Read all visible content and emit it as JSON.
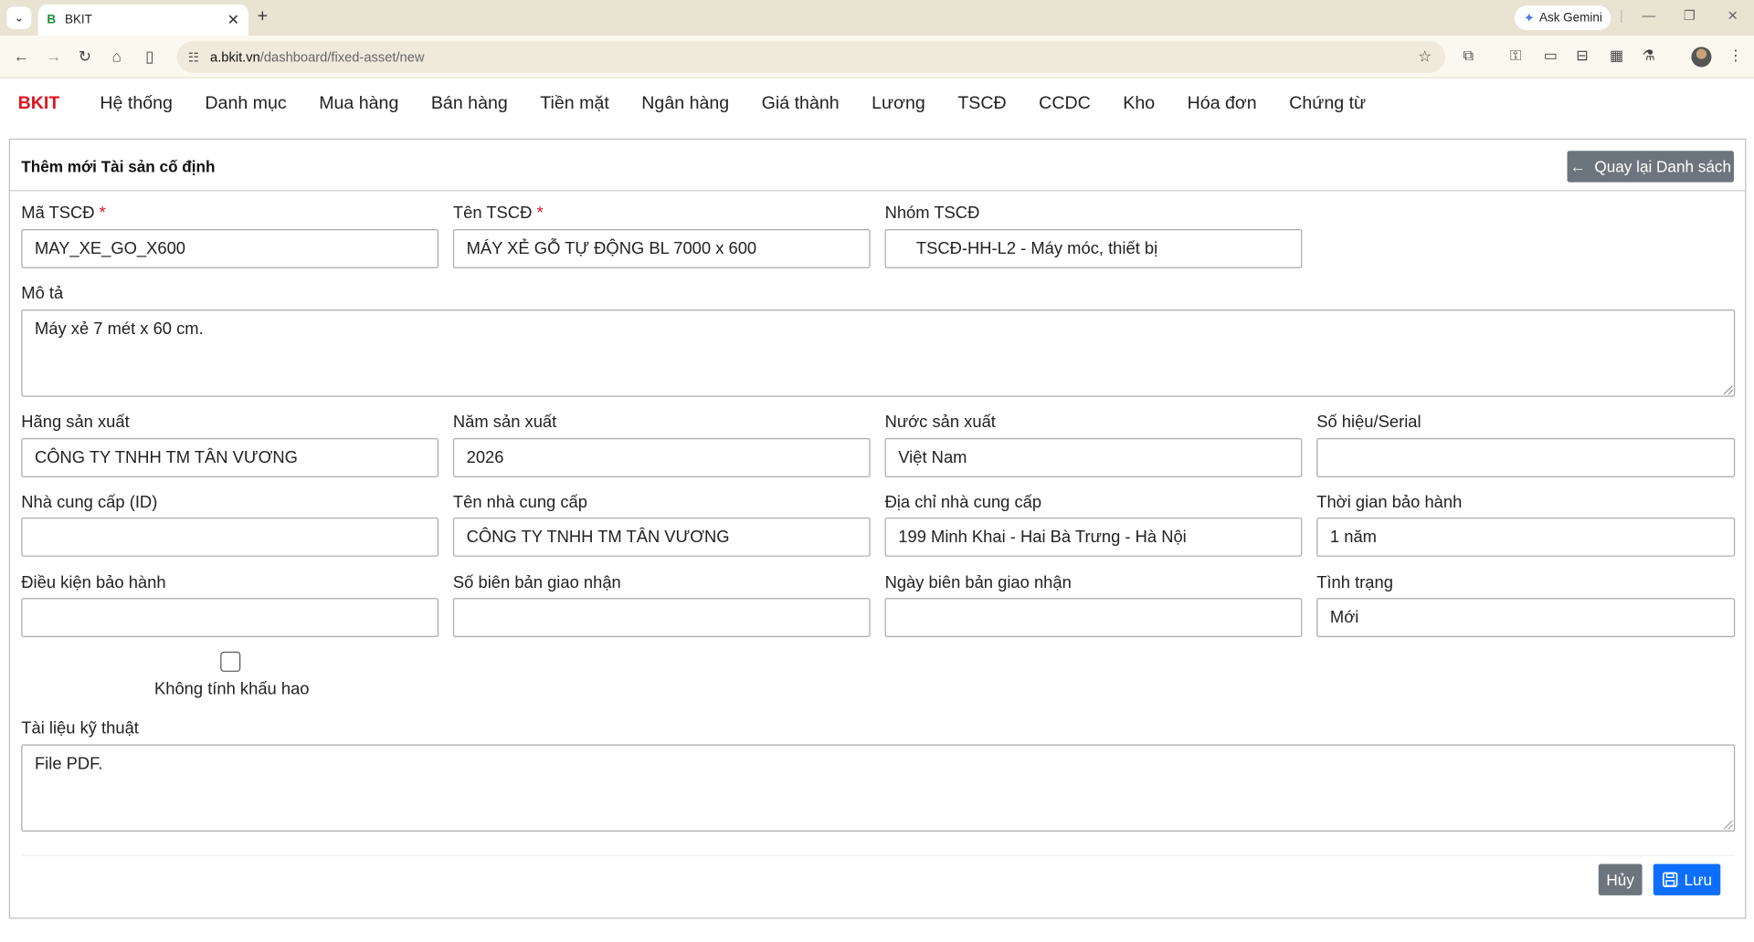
{
  "browser": {
    "tab_title": "BKIT",
    "tab_favicon": "B",
    "url_host": "a.bkit.vn",
    "url_path": "/dashboard/fixed-asset/new",
    "gemini_label": "Ask Gemini"
  },
  "app": {
    "brand": "BKIT",
    "nav": [
      "Hệ thống",
      "Danh mục",
      "Mua hàng",
      "Bán hàng",
      "Tiền mặt",
      "Ngân hàng",
      "Giá thành",
      "Lương",
      "TSCĐ",
      "CCDC",
      "Kho",
      "Hóa đơn",
      "Chứng từ"
    ]
  },
  "form": {
    "title": "Thêm mới Tài sản cố định",
    "back_label": "Quay lại Danh sách",
    "ma_tscd": {
      "label": "Mã TSCĐ",
      "value": "MAY_XE_GO_X600"
    },
    "ten_tscd": {
      "label": "Tên TSCĐ",
      "value": "MÁY XẺ GỖ TỰ ĐỘNG BL 7000 x 600"
    },
    "nhom_tscd": {
      "label": "Nhóm TSCĐ",
      "value": "TSCĐ-HH-L2 - Máy móc, thiết bị"
    },
    "mo_ta": {
      "label": "Mô tả",
      "value": "Máy xẻ 7 mét x 60 cm."
    },
    "hang_sx": {
      "label": "Hãng sản xuất",
      "value": "CÔNG TY TNHH TM TÂN VƯƠNG"
    },
    "nam_sx": {
      "label": "Năm sản xuất",
      "value": "2026"
    },
    "nuoc_sx": {
      "label": "Nước sản xuất",
      "value": "Việt Nam"
    },
    "serial": {
      "label": "Số hiệu/Serial",
      "value": ""
    },
    "ncc_id": {
      "label": "Nhà cung cấp (ID)",
      "value": ""
    },
    "ten_ncc": {
      "label": "Tên nhà cung cấp",
      "value": "CÔNG TY TNHH TM TÂN VƯƠNG"
    },
    "dia_chi_ncc": {
      "label": "Địa chỉ nhà cung cấp",
      "value": "199 Minh Khai - Hai Bà Trưng - Hà Nội"
    },
    "bao_hanh": {
      "label": "Thời gian bảo hành",
      "value": "1 năm"
    },
    "dk_bao_hanh": {
      "label": "Điều kiện bảo hành",
      "value": ""
    },
    "so_bb": {
      "label": "Số biên bản giao nhận",
      "value": ""
    },
    "ngay_bb": {
      "label": "Ngày biên bản giao nhận",
      "value": ""
    },
    "tinh_trang": {
      "label": "Tình trạng",
      "value": "Mới"
    },
    "khau_hao": {
      "label": "Không tính khấu hao",
      "checked": false
    },
    "tai_lieu": {
      "label": "Tài liệu kỹ thuật",
      "value": "File PDF."
    },
    "cancel_label": "Hủy",
    "save_label": "Lưu",
    "required_mark": "*"
  }
}
